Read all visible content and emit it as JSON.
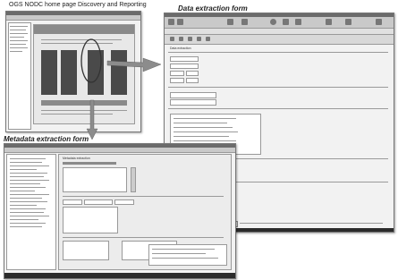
{
  "captions": {
    "home": "OGS NODC home page Discovery and Reporting",
    "data_form": "Data extraction form",
    "metadata_form": "Metadata extraction form"
  },
  "data_window": {
    "title": "Data extraction",
    "buttons": [
      "Help",
      "Clear",
      "Show NetCDF",
      "Send"
    ]
  },
  "metadata_window": {
    "title": "Metadata extraction"
  },
  "colors": {
    "arrow": "#8c8c8c",
    "highlight_ring": "#333333"
  }
}
